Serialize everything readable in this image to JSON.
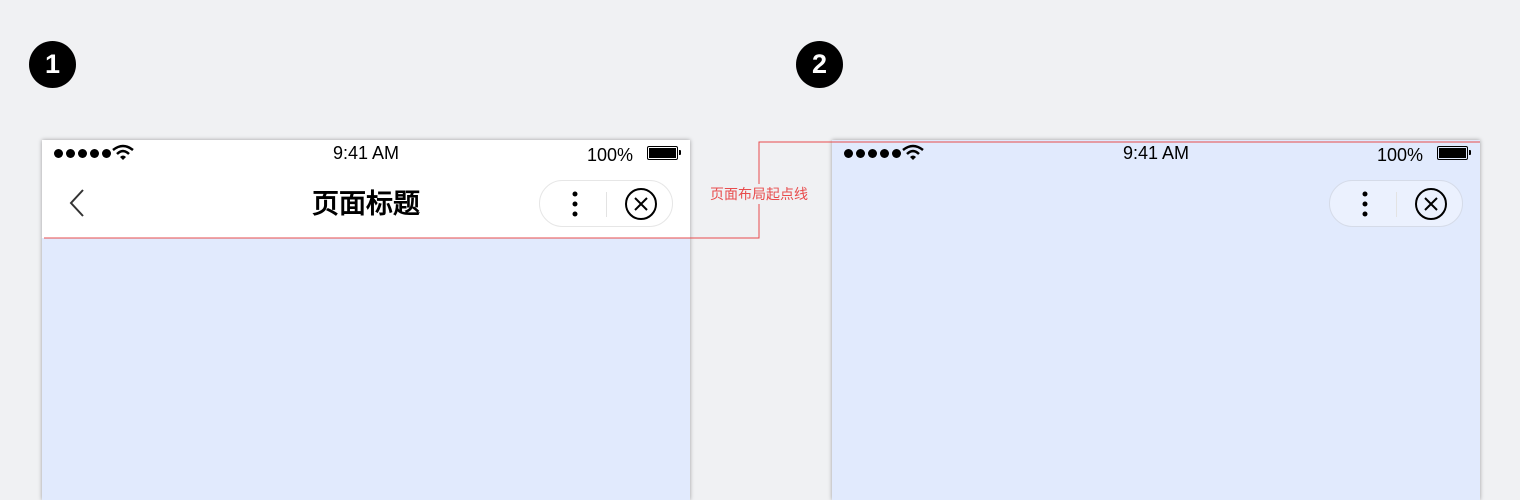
{
  "badges": [
    "1",
    "2"
  ],
  "phone1": {
    "status": {
      "time": "9:41 AM",
      "battery": "100%"
    },
    "nav": {
      "title": "页面标题"
    }
  },
  "phone2": {
    "status": {
      "time": "9:41 AM",
      "battery": "100%"
    }
  },
  "annotation": {
    "label": "页面布局起点线",
    "color": "#e84c4c"
  },
  "colors": {
    "page_bg": "#e1eafd",
    "canvas_bg": "#f0f1f3"
  }
}
